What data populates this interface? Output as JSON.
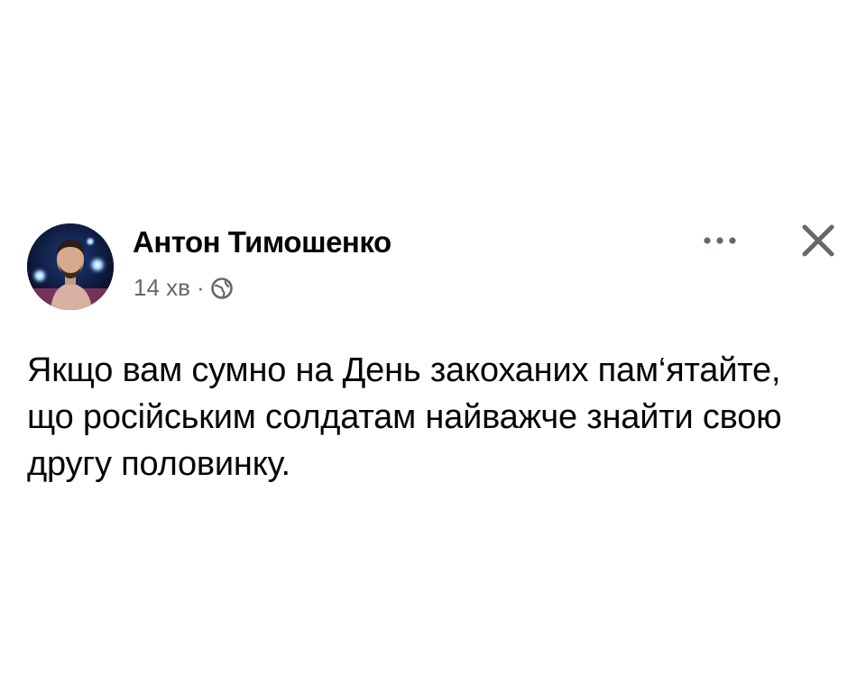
{
  "post": {
    "author": {
      "name": "Антон Тимошенко",
      "avatar_icon": "profile-photo"
    },
    "meta": {
      "time": "14 хв",
      "separator": "·",
      "audience_icon": "globe-icon"
    },
    "actions": {
      "more_icon": "ellipsis-icon",
      "close_icon": "close-icon"
    },
    "text_lines": [
      "Якщо вам сумно на День закоханих пам‘ятайте,",
      "що російським солдатам найважче знайти свою",
      "другу половинку."
    ]
  },
  "colors": {
    "name": "#050505",
    "secondary_text": "#65676b",
    "body_text": "#050505",
    "background": "#ffffff"
  }
}
